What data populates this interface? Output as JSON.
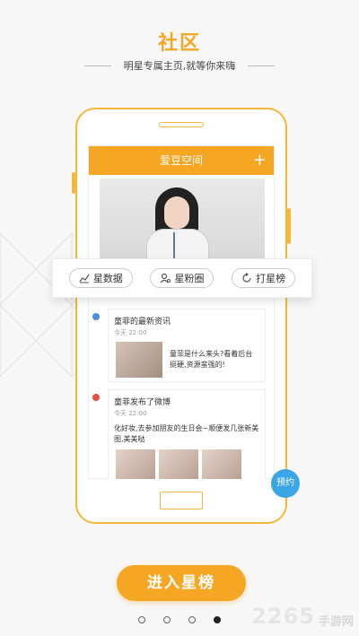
{
  "header": {
    "title": "社区",
    "subtitle": "明星专属主页,就等你来嗨"
  },
  "app": {
    "title": "爱豆空间",
    "add_icon": "plus-icon"
  },
  "tabs": [
    {
      "label": "星数据",
      "icon": "chart-line-icon"
    },
    {
      "label": "星粉圈",
      "icon": "user-circle-icon"
    },
    {
      "label": "打星榜",
      "icon": "refresh-icon"
    }
  ],
  "feed": [
    {
      "title": "童菲的最新资讯",
      "time": "今天 22:00",
      "text": "童菲是什么来头?看着后台挺硬,资源蛮强的!",
      "dot_color": "#4a90e2"
    },
    {
      "title": "童菲发布了微博",
      "time": "今天 22:00",
      "text": "化好妆,去参加朋友的生日会~顺便发几张新美图,美美哒",
      "dot_color": "#e74c3c"
    }
  ],
  "reserve_label": "预约",
  "cta_label": "进入星榜",
  "pager": {
    "total": 4,
    "active_index": 3
  },
  "watermark": {
    "number": "2265",
    "site": "手游网"
  },
  "colors": {
    "accent": "#f5a623",
    "reserve": "#3aa6e6"
  }
}
